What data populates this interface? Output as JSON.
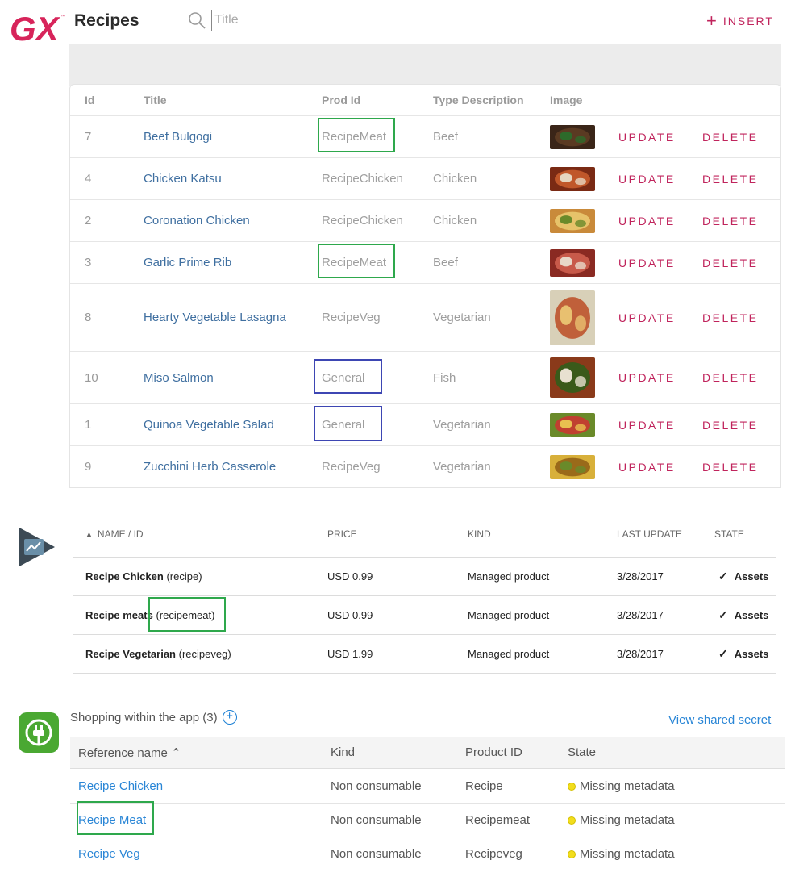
{
  "header": {
    "app_title": "Recipes",
    "search_placeholder": "Title",
    "insert_label": "INSERT",
    "logo_icon": "gx-logo"
  },
  "gx_table": {
    "columns": [
      "Id",
      "Title",
      "Prod Id",
      "Type Description",
      "Image"
    ],
    "update_label": "UPDATE",
    "delete_label": "DELETE",
    "rows": [
      {
        "id": "7",
        "title": "Beef Bulgogi",
        "prod_id": "RecipeMeat",
        "type": "Beef",
        "image": "beef-bulgogi-photo"
      },
      {
        "id": "4",
        "title": "Chicken Katsu",
        "prod_id": "RecipeChicken",
        "type": "Chicken",
        "image": "chicken-katsu-photo"
      },
      {
        "id": "2",
        "title": "Coronation Chicken",
        "prod_id": "RecipeChicken",
        "type": "Chicken",
        "image": "coronation-chicken-photo"
      },
      {
        "id": "3",
        "title": "Garlic Prime Rib",
        "prod_id": "RecipeMeat",
        "type": "Beef",
        "image": "garlic-prime-rib-photo"
      },
      {
        "id": "8",
        "title": "Hearty Vegetable Lasagna",
        "prod_id": "RecipeVeg",
        "type": "Vegetarian",
        "image": "lasagna-photo"
      },
      {
        "id": "10",
        "title": "Miso Salmon",
        "prod_id": "General",
        "type": "Fish",
        "image": "miso-salmon-photo"
      },
      {
        "id": "1",
        "title": "Quinoa Vegetable Salad",
        "prod_id": "General",
        "type": "Vegetarian",
        "image": "quinoa-salad-photo"
      },
      {
        "id": "9",
        "title": "Zucchini Herb Casserole",
        "prod_id": "RecipeVeg",
        "type": "Vegetarian",
        "image": "zucchini-casserole-photo"
      }
    ]
  },
  "google_play": {
    "logo_icon": "google-play-console-icon",
    "columns": [
      "NAME / ID",
      "PRICE",
      "KIND",
      "LAST UPDATE",
      "STATE"
    ],
    "rows": [
      {
        "name": "Recipe Chicken",
        "id": "(recipe)",
        "price": "USD 0.99",
        "kind": "Managed product",
        "updated": "3/28/2017",
        "state": "Assets"
      },
      {
        "name": "Recipe meats",
        "id": "(recipemeat)",
        "price": "USD 0.99",
        "kind": "Managed product",
        "updated": "3/28/2017",
        "state": "Assets"
      },
      {
        "name": "Recipe Vegetarian",
        "id": "(recipeveg)",
        "price": "USD 1.99",
        "kind": "Managed product",
        "updated": "3/28/2017",
        "state": "Assets"
      }
    ]
  },
  "itunes": {
    "logo_icon": "itunes-connect-plug-icon",
    "subtitle": "Shopping within the app (3)",
    "shared_secret_link": "View shared secret",
    "columns": [
      "Reference name ⌃",
      "Kind",
      "Product ID",
      "State"
    ],
    "rows": [
      {
        "ref": "Recipe Chicken",
        "kind": "Non consumable",
        "product_id": "Recipe",
        "state": "Missing metadata"
      },
      {
        "ref": "Recipe Meat",
        "kind": "Non consumable",
        "product_id": "Recipemeat",
        "state": "Missing metadata"
      },
      {
        "ref": "Recipe Veg",
        "kind": "Non consumable",
        "product_id": "Recipeveg",
        "state": "Missing metadata"
      }
    ]
  },
  "colors": {
    "accent": "#c0245c",
    "link": "#3f6fa0",
    "highlight_green": "#2ea84c",
    "highlight_blue": "#3d46b3",
    "status_yellow": "#f2dd1d"
  }
}
